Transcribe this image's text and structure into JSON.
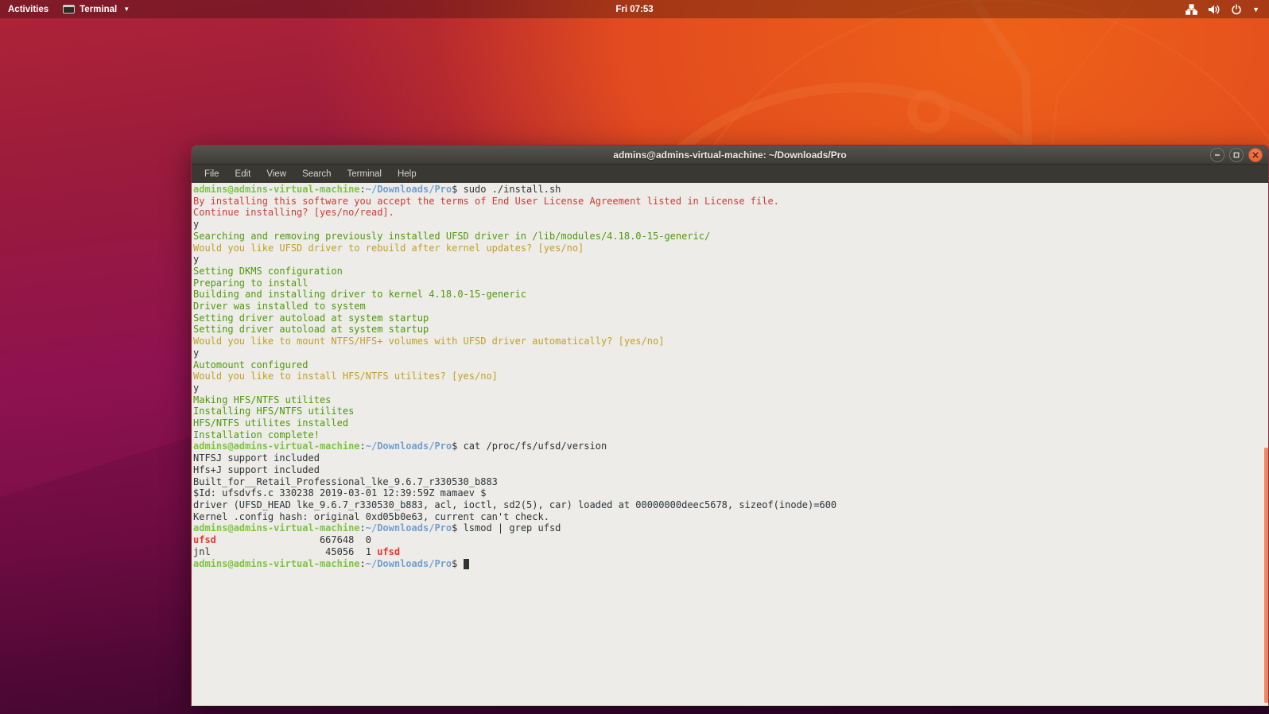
{
  "top_bar": {
    "activities_label": "Activities",
    "app_menu_label": "Terminal",
    "clock": "Fri 07:53",
    "tray_icons": [
      "network-icon",
      "volume-icon",
      "power-icon",
      "chevron-down-icon"
    ]
  },
  "window": {
    "title": "admins@admins-virtual-machine: ~/Downloads/Pro",
    "menus": [
      "File",
      "Edit",
      "View",
      "Search",
      "Terminal",
      "Help"
    ],
    "controls": [
      "minimize",
      "maximize",
      "close"
    ]
  },
  "colors": {
    "accent_orange": "#E95420",
    "terminal_bg": "#EDECE9",
    "prompt_user_green": "#7EC53F",
    "prompt_path_blue": "#729FCF",
    "info_green": "#4E9A06",
    "question_yellow": "#C3A021",
    "warning_red": "#CC3B34",
    "grep_match_red": "#E5392E"
  },
  "terminal": {
    "prompt": {
      "user_host": "admins@admins-virtual-machine",
      "separator": ":",
      "path": "~/Downloads/Pro",
      "dollar": "$ "
    },
    "lines": [
      {
        "prompt": true,
        "segments": [
          [
            "fg",
            "sudo ./install.sh"
          ]
        ]
      },
      {
        "segments": [
          [
            "red",
            "By installing this software you accept the terms of End User License Agreement listed in License file."
          ]
        ]
      },
      {
        "segments": [
          [
            "red",
            "Continue installing? [yes/no/read]."
          ]
        ]
      },
      {
        "segments": [
          [
            "fg",
            "y"
          ]
        ]
      },
      {
        "segments": [
          [
            "green",
            "Searching and removing previously installed UFSD driver in /lib/modules/4.18.0-15-generic/"
          ]
        ]
      },
      {
        "segments": [
          [
            "yellow",
            "Would you like UFSD driver to rebuild after kernel updates? [yes/no]"
          ]
        ]
      },
      {
        "segments": [
          [
            "fg",
            "y"
          ]
        ]
      },
      {
        "segments": [
          [
            "green",
            "Setting DKMS configuration"
          ]
        ]
      },
      {
        "segments": [
          [
            "green",
            "Preparing to install"
          ]
        ]
      },
      {
        "segments": [
          [
            "green",
            "Building and installing driver to kernel 4.18.0-15-generic"
          ]
        ]
      },
      {
        "segments": [
          [
            "green",
            "Driver was installed to system"
          ]
        ]
      },
      {
        "segments": [
          [
            "green",
            "Setting driver autoload at system startup"
          ]
        ]
      },
      {
        "segments": [
          [
            "green",
            "Setting driver autoload at system startup"
          ]
        ]
      },
      {
        "segments": [
          [
            "yellow",
            "Would you like to mount NTFS/HFS+ volumes with UFSD driver automatically? [yes/no]"
          ]
        ]
      },
      {
        "segments": [
          [
            "fg",
            "y"
          ]
        ]
      },
      {
        "segments": [
          [
            "green",
            "Automount configured"
          ]
        ]
      },
      {
        "segments": [
          [
            "yellow",
            "Would you like to install HFS/NTFS utilites? [yes/no]"
          ]
        ]
      },
      {
        "segments": [
          [
            "fg",
            "y"
          ]
        ]
      },
      {
        "segments": [
          [
            "green",
            "Making HFS/NTFS utilites"
          ]
        ]
      },
      {
        "segments": [
          [
            "green",
            "Installing HFS/NTFS utilites"
          ]
        ]
      },
      {
        "segments": [
          [
            "green",
            "HFS/NTFS utilites installed"
          ]
        ]
      },
      {
        "segments": [
          [
            "green",
            "Installation complete!"
          ]
        ]
      },
      {
        "prompt": true,
        "segments": [
          [
            "fg",
            "cat /proc/fs/ufsd/version"
          ]
        ]
      },
      {
        "segments": [
          [
            "fg",
            "NTFSJ support included"
          ]
        ]
      },
      {
        "segments": [
          [
            "fg",
            "Hfs+J support included"
          ]
        ]
      },
      {
        "segments": [
          [
            "fg",
            "Built_for__Retail_Professional_lke_9.6.7_r330530_b883"
          ]
        ]
      },
      {
        "segments": [
          [
            "fg",
            "$Id: ufsdvfs.c 330238 2019-03-01 12:39:59Z mamaev $"
          ]
        ]
      },
      {
        "segments": [
          [
            "fg",
            "driver (UFSD_HEAD lke_9.6.7_r330530_b883, acl, ioctl, sd2(5), car) loaded at 00000000deec5678, sizeof(inode)=600"
          ]
        ]
      },
      {
        "segments": [
          [
            "fg",
            "Kernel .config hash: original 0xd05b0e63, current can't check."
          ]
        ]
      },
      {
        "prompt": true,
        "segments": [
          [
            "fg",
            "lsmod | grep ufsd"
          ]
        ]
      },
      {
        "segments": [
          [
            "redBold",
            "ufsd"
          ],
          [
            "fg",
            "                  667648  0"
          ]
        ]
      },
      {
        "segments": [
          [
            "fg",
            "jnl                    45056  1 "
          ],
          [
            "redBold",
            "ufsd"
          ]
        ]
      },
      {
        "prompt": true,
        "segments": [],
        "cursor": true
      }
    ]
  }
}
